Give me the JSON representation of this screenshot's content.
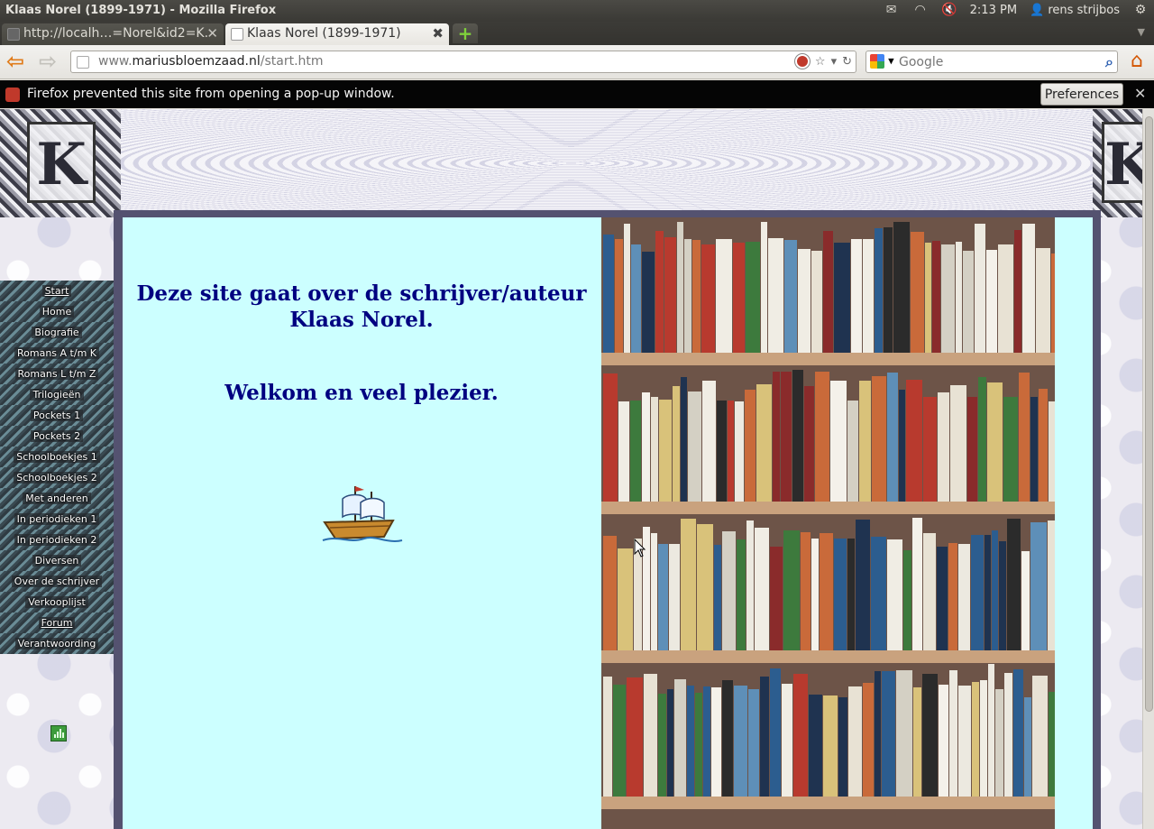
{
  "os": {
    "window_title": "Klaas Norel (1899-1971) - Mozilla Firefox",
    "clock": "2:13 PM",
    "user": "rens strijbos"
  },
  "tabs": [
    {
      "label": "http://localh…=Norel&id2=K."
    },
    {
      "label": "Klaas Norel (1899-1971)"
    }
  ],
  "address_bar": {
    "prefix": "www.",
    "domain": "mariusbloemzaad.nl",
    "path": "/start.htm"
  },
  "search": {
    "placeholder": "Google"
  },
  "popup_bar": {
    "message": "Firefox prevented this site from opening a pop-up window.",
    "preferences_label": "Preferences"
  },
  "page": {
    "heading_line1": "Deze site gaat over de schrijver/auteur",
    "heading_line2": "Klaas Norel.",
    "welcome": "Welkom en veel plezier."
  },
  "menu": [
    {
      "label": "Start",
      "underline": true
    },
    {
      "label": "Home"
    },
    {
      "label": "Biografie"
    },
    {
      "label": "Romans A t/m K"
    },
    {
      "label": "Romans L t/m Z"
    },
    {
      "label": "Trilogieën"
    },
    {
      "label": "Pockets 1"
    },
    {
      "label": "Pockets 2"
    },
    {
      "label": "Schoolboekjes 1"
    },
    {
      "label": "Schoolboekjes 2"
    },
    {
      "label": "Met anderen"
    },
    {
      "label": "In periodieken 1"
    },
    {
      "label": "In periodieken 2"
    },
    {
      "label": "Diversen"
    },
    {
      "label": "Over de schrijver"
    },
    {
      "label": "Verkooplijst"
    },
    {
      "label": "Forum",
      "underline": true
    },
    {
      "label": "Verantwoording"
    }
  ],
  "colors": {
    "content_bg": "#ccffff",
    "heading_text": "#000080",
    "frame": "#545270",
    "popup_bar_bg": "#050505"
  },
  "icons": {
    "back": "back-arrow-icon",
    "forward": "forward-arrow-icon",
    "home": "home-icon",
    "search": "magnifier-icon",
    "ship": "sailing-ship-icon",
    "counter": "bar-chart-counter-icon"
  }
}
